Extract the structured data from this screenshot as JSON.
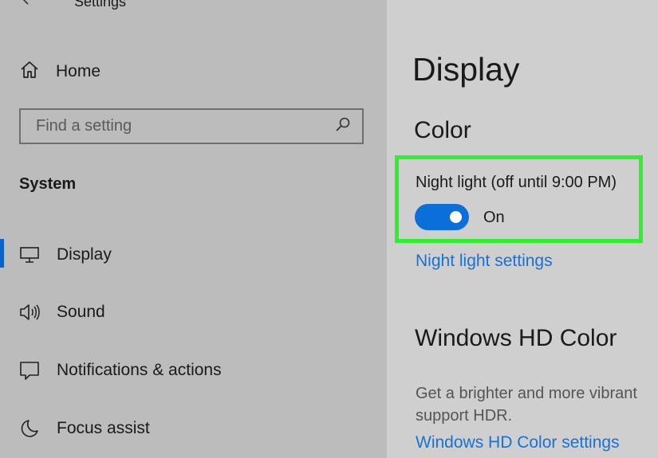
{
  "window": {
    "title": "Settings"
  },
  "sidebar": {
    "home_label": "Home",
    "search": {
      "placeholder": "Find a setting",
      "value": ""
    },
    "section_heading": "System",
    "items": [
      {
        "label": "Display",
        "icon": "monitor-icon",
        "active": true
      },
      {
        "label": "Sound",
        "icon": "speaker-icon",
        "active": false
      },
      {
        "label": "Notifications & actions",
        "icon": "notification-icon",
        "active": false
      },
      {
        "label": "Focus assist",
        "icon": "moon-icon",
        "active": false
      }
    ]
  },
  "main": {
    "page_title": "Display",
    "color_heading": "Color",
    "night_light": {
      "label": "Night light (off until 9:00 PM)",
      "toggle_state": "On",
      "toggle_on": true,
      "settings_link": "Night light settings"
    },
    "hd_color": {
      "heading": "Windows HD Color",
      "description_line1": "Get a brighter and more vibrant",
      "description_line2": "support HDR.",
      "settings_link": "Windows HD Color settings"
    }
  },
  "colors": {
    "accent": "#0a6fd8",
    "link": "#1672d6",
    "highlight": "#2ef02e",
    "sidebar_bg": "#bcbcbc",
    "main_bg": "#cfcfcf"
  }
}
